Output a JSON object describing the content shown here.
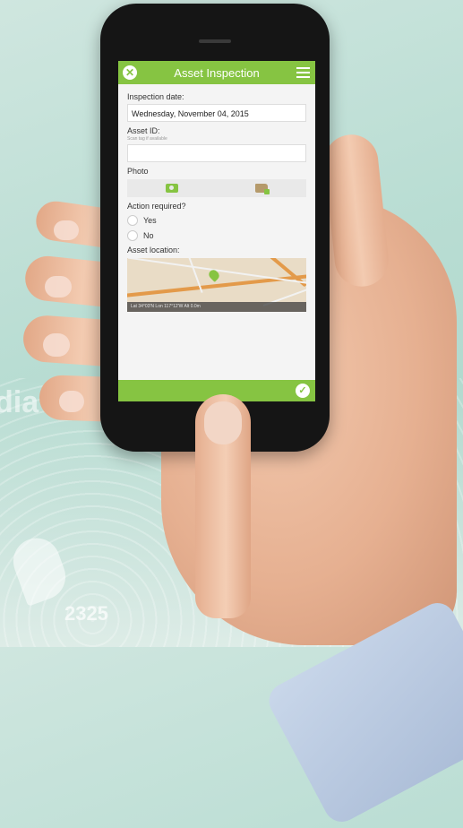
{
  "app": {
    "title": "Asset Inspection",
    "icons": {
      "close": "close-icon",
      "menu": "hamburger-menu-icon",
      "submit": "checkmark-icon"
    },
    "accent_color": "#86c442"
  },
  "form": {
    "inspection_date": {
      "label": "Inspection date:",
      "value": "Wednesday, November 04, 2015"
    },
    "asset_id": {
      "label": "Asset ID:",
      "hint": "Scan tag if available",
      "value": ""
    },
    "photo": {
      "label": "Photo",
      "camera_icon": "camera-icon",
      "gallery_icon": "folder-image-icon"
    },
    "action_required": {
      "label": "Action required?",
      "options": [
        "Yes",
        "No"
      ]
    },
    "asset_location": {
      "label": "Asset location:",
      "status": "Lat 34°03'N Lon 117°12'W Alt 0.0m"
    }
  },
  "background": {
    "caption": "dia",
    "badge": "2325"
  }
}
